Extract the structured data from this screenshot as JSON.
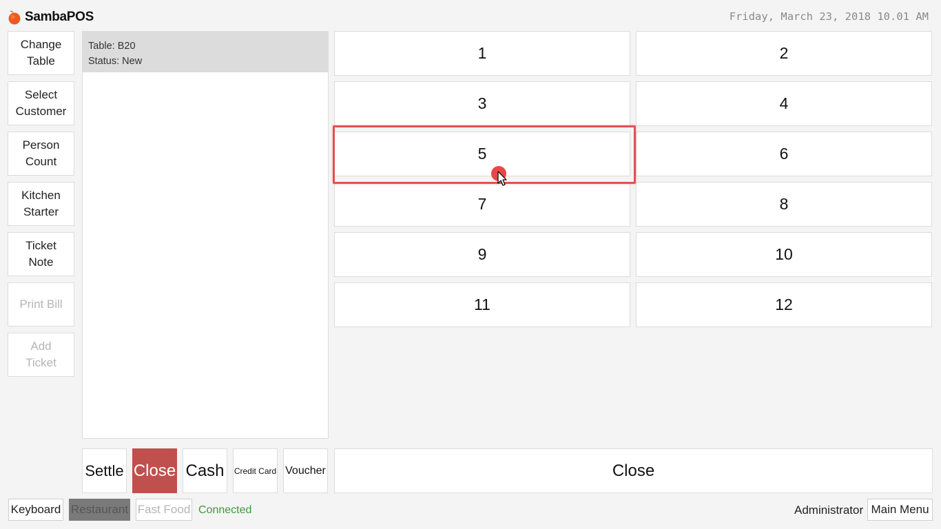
{
  "app": {
    "name": "SambaPOS",
    "datetime": "Friday, March 23, 2018 10.01 AM"
  },
  "commands": [
    {
      "label": "Change\nTable",
      "enabled": true
    },
    {
      "label": "Select\nCustomer",
      "enabled": true
    },
    {
      "label": "Person\nCount",
      "enabled": true
    },
    {
      "label": "Kitchen\nStarter",
      "enabled": true
    },
    {
      "label": "Ticket\nNote",
      "enabled": true
    },
    {
      "label": "Print Bill",
      "enabled": false
    },
    {
      "label": "Add\nTicket",
      "enabled": false
    }
  ],
  "ticket": {
    "table": "Table: B20",
    "status": "Status: New"
  },
  "numpad": [
    "1",
    "2",
    "3",
    "4",
    "5",
    "6",
    "7",
    "8",
    "9",
    "10",
    "11",
    "12"
  ],
  "highlighted_key": "5",
  "payment": {
    "settle": "Settle",
    "close": "Close",
    "cash": "Cash",
    "credit_card": "Credit Card",
    "voucher": "Voucher"
  },
  "close_button": "Close",
  "footer": {
    "keyboard": "Keyboard",
    "restaurant": "Restaurant",
    "fast_food": "Fast Food",
    "connection": "Connected",
    "user": "Administrator",
    "main_menu": "Main Menu"
  },
  "colors": {
    "accent_red": "#c0504d",
    "connected_green": "#3c9a3c",
    "highlight": "#e05252"
  },
  "icons": {
    "logo": "sambapos-logo-icon",
    "cursor": "mouse-cursor-icon"
  }
}
